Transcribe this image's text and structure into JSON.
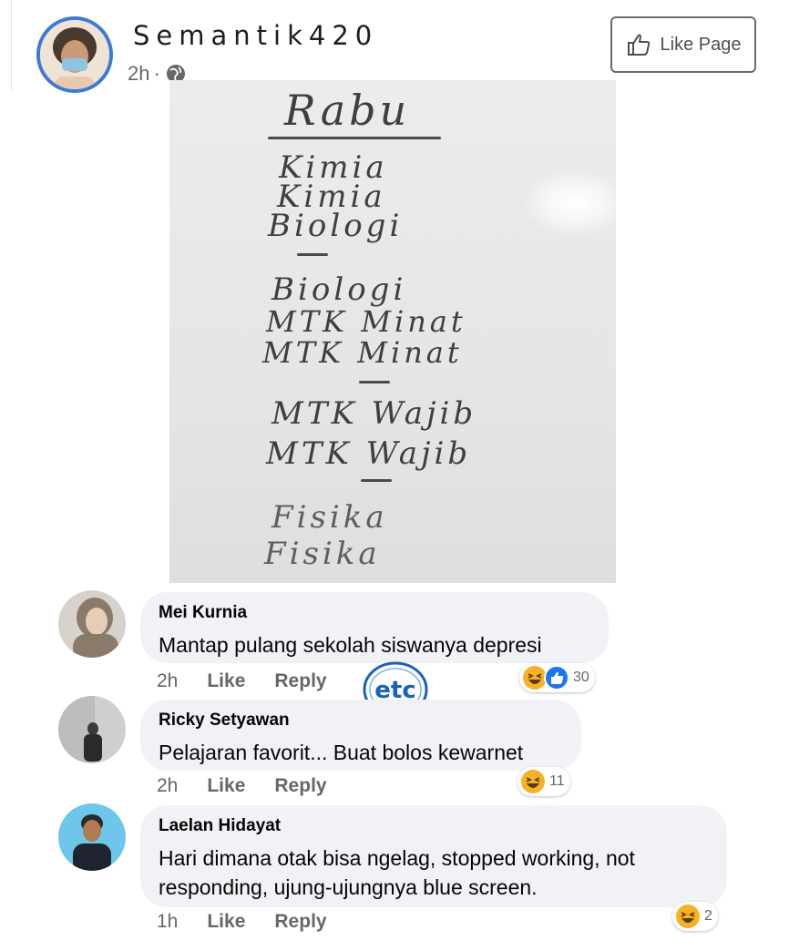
{
  "post": {
    "page_name": "Semantik420",
    "time": "2h",
    "separator": "·",
    "privacy_icon": "globe-icon",
    "like_page_label": "Like Page",
    "photo_lines": {
      "title": "Rabu",
      "l1": "Kimia",
      "l2": "Kimia",
      "l3": "Biologi",
      "l4": "Biologi",
      "l5": "MTK Minat",
      "l6": "MTK Minat",
      "l7": "MTK Wajib",
      "l8": "MTK Wajib",
      "l9": "Fisika",
      "l10": "Fisika"
    }
  },
  "comments": [
    {
      "name": "Mei Kurnia",
      "text": "Mantap pulang sekolah siswanya depresi",
      "time": "2h",
      "like": "Like",
      "reply": "Reply",
      "reactions": [
        "haha-icon",
        "like-icon"
      ],
      "count": "30"
    },
    {
      "name": "Ricky Setyawan",
      "text": "Pelajaran favorit... Buat bolos kewarnet",
      "time": "2h",
      "like": "Like",
      "reply": "Reply",
      "reactions": [
        "haha-icon"
      ],
      "count": "11"
    },
    {
      "name": "Laelan Hidayat",
      "text": "Hari dimana otak bisa ngelag, stopped working, not responding, ujung-ujungnya blue screen.",
      "time": "1h",
      "like": "Like",
      "reply": "Reply",
      "reactions": [
        "haha-icon"
      ],
      "count": "2"
    }
  ],
  "watermark": {
    "text": "etc"
  },
  "colors": {
    "accent": "#3b7bd6",
    "bubble": "#f0f2f5",
    "muted": "#65676b",
    "haha": "#f7b125",
    "like": "#1877f2"
  }
}
